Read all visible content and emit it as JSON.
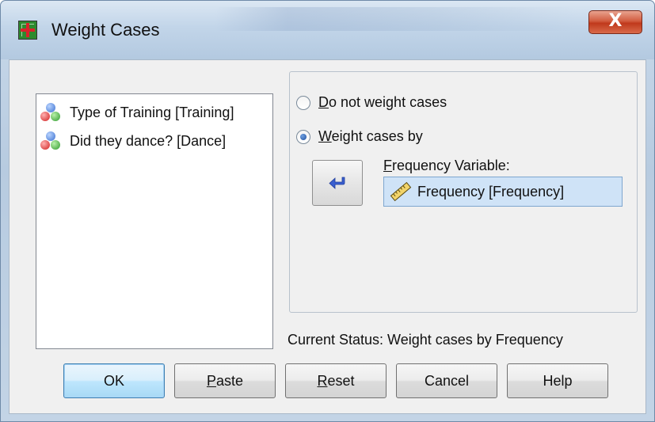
{
  "window": {
    "title": "Weight Cases",
    "close_label": "X"
  },
  "variables": {
    "items": [
      {
        "label": "Type of Training [Training]",
        "icon": "nominal-variable-icon"
      },
      {
        "label": "Did they dance? [Dance]",
        "icon": "nominal-variable-icon"
      }
    ]
  },
  "options": {
    "no_weight": {
      "accel": "D",
      "rest": "o not weight cases",
      "checked": false
    },
    "weight_by": {
      "accel": "W",
      "rest": "eight cases by",
      "checked": true
    }
  },
  "frequency": {
    "label_accel": "F",
    "label_rest": "requency Variable:",
    "value": "Frequency [Frequency]",
    "icon": "scale-variable-icon",
    "move_icon": "arrow-left-icon"
  },
  "status": {
    "text": "Current Status: Weight cases by Frequency"
  },
  "buttons": {
    "ok": "OK",
    "paste_accel": "P",
    "paste_rest": "aste",
    "reset_accel": "R",
    "reset_rest": "eset",
    "cancel": "Cancel",
    "help": "Help"
  },
  "colors": {
    "selection": "#cfe3f7",
    "close_button": "#c0391c",
    "default_button": "#bee6fd"
  }
}
